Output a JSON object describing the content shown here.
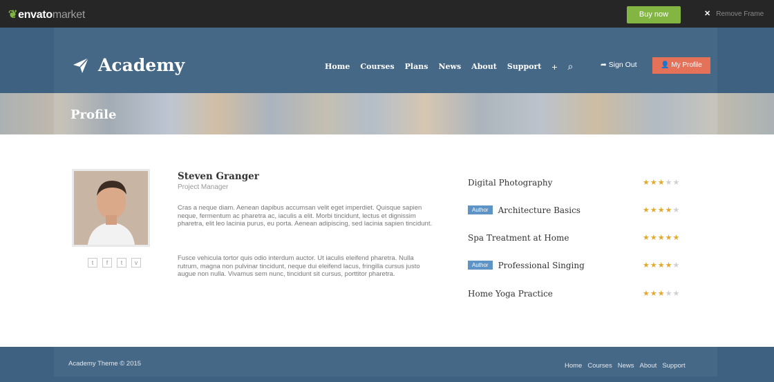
{
  "envato": {
    "brand": "envato",
    "market": "market",
    "buy_label": "Buy now",
    "remove_label": "Remove Frame"
  },
  "header": {
    "brand": "Academy",
    "nav": [
      "Home",
      "Courses",
      "Plans",
      "News",
      "About",
      "Support"
    ],
    "signout": "Sign Out",
    "profile": "My Profile"
  },
  "band": {
    "title": "Profile"
  },
  "profile": {
    "name": "Steven Granger",
    "role": "Project Manager",
    "bio1": "Cras a neque diam. Aenean dapibus accumsan velit eget imperdiet. Quisque sapien neque, fermentum ac pharetra ac, iaculis a elit. Morbi tincidunt, lectus et dignissim pharetra, elit leo lacinia purus, eu porta. Aenean adipiscing, sed lacinia sapien tincidunt.",
    "bio2": "Fusce vehicula tortor quis odio interdum auctor. Ut iaculis eleifend pharetra. Nulla rutrum, magna non pulvinar tincidunt, neque dui eleifend lacus, fringilla cursus justo augue non nulla. Vivamus sem nunc, tincidunt sit cursus, porttitor pharetra.",
    "socials": [
      "tumblr-icon",
      "facebook-icon",
      "twitter-icon",
      "vimeo-icon"
    ],
    "social_glyphs": [
      "t",
      "f",
      "t",
      "v"
    ]
  },
  "courses": [
    {
      "title": "Digital Photography",
      "author": false,
      "rating": 3
    },
    {
      "title": "Architecture Basics",
      "author": true,
      "rating": 4
    },
    {
      "title": "Spa Treatment at Home",
      "author": false,
      "rating": 5
    },
    {
      "title": "Professional Singing",
      "author": true,
      "rating": 4
    },
    {
      "title": "Home Yoga Practice",
      "author": false,
      "rating": 3
    }
  ],
  "author_label": "Author",
  "footer": {
    "copyright": "Academy Theme © 2015",
    "links": [
      "Home",
      "Courses",
      "News",
      "About",
      "Support"
    ]
  },
  "colors": {
    "header": "#466887",
    "accent_green": "#82b541",
    "accent_orange": "#e57158",
    "author_badge": "#5e93c5",
    "star": "#e3a92e"
  }
}
